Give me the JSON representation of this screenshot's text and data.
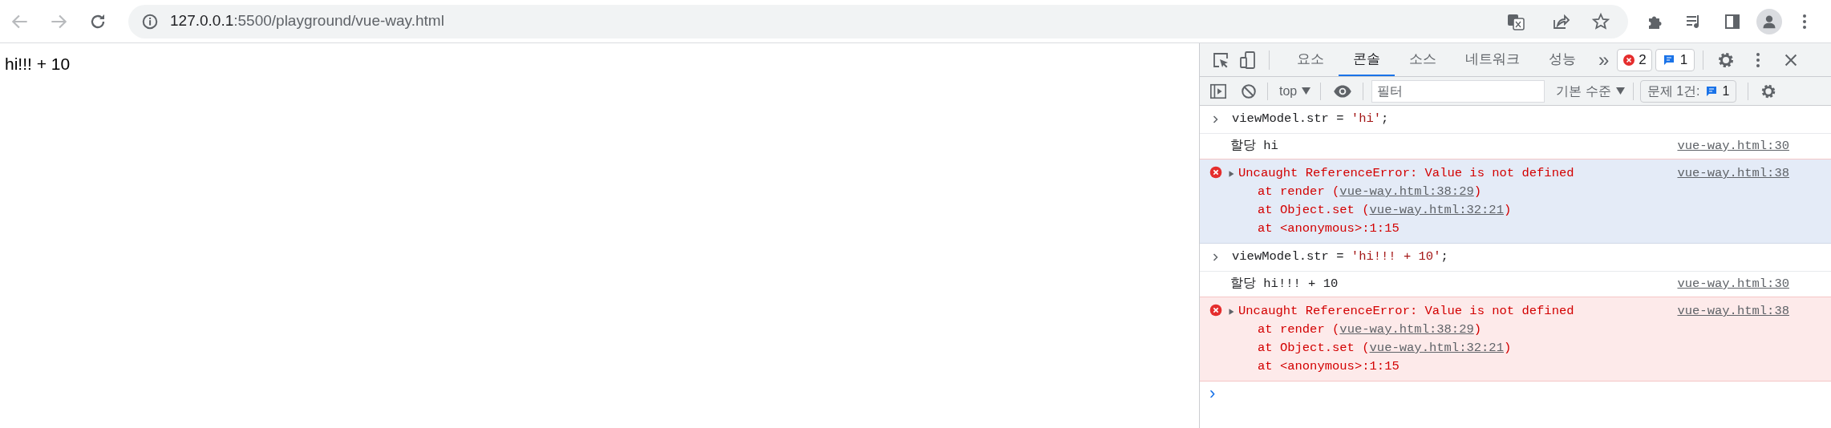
{
  "browser": {
    "back_disabled": true,
    "forward_disabled": true,
    "address": {
      "host": "127.0.0.1",
      "rest": ":5500/playground/vue-way.html"
    }
  },
  "page": {
    "text": "hi!!! + 10"
  },
  "devtools": {
    "tabs": [
      {
        "label": "요소",
        "selected": false
      },
      {
        "label": "콘솔",
        "selected": true
      },
      {
        "label": "소스",
        "selected": false
      },
      {
        "label": "네트워크",
        "selected": false
      },
      {
        "label": "성능",
        "selected": false
      }
    ],
    "more": "»",
    "error_count": "2",
    "message_count": "1",
    "context": "top",
    "filter": {
      "placeholder": "필터"
    },
    "level": "기본 수준",
    "issues_label": "문제 1건:",
    "issues_count": "1",
    "console": [
      {
        "kind": "input",
        "selected": false,
        "parts": [
          {
            "text": "viewModel.str = ",
            "string": false
          },
          {
            "text": "'hi'",
            "string": true
          },
          {
            "text": ";",
            "string": false
          }
        ]
      },
      {
        "kind": "log",
        "selected": false,
        "text": "할당 hi",
        "source": "vue-way.html:30"
      },
      {
        "kind": "error",
        "selected": true,
        "message": "Uncaught ReferenceError: Value is not defined",
        "source": "vue-way.html:38",
        "stack": [
          {
            "prefix": "at render (",
            "link": "vue-way.html:38:29",
            "suffix": ")"
          },
          {
            "prefix": "at Object.set (",
            "link": "vue-way.html:32:21",
            "suffix": ")"
          },
          {
            "prefix": "at <anonymous>:1:15"
          }
        ]
      },
      {
        "kind": "input",
        "selected": false,
        "parts": [
          {
            "text": "viewModel.str = ",
            "string": false
          },
          {
            "text": "'hi!!! + 10'",
            "string": true
          },
          {
            "text": ";",
            "string": false
          }
        ]
      },
      {
        "kind": "log",
        "selected": false,
        "text": "할당 hi!!! + 10",
        "source": "vue-way.html:30"
      },
      {
        "kind": "error",
        "selected": false,
        "message": "Uncaught ReferenceError: Value is not defined",
        "source": "vue-way.html:38",
        "stack": [
          {
            "prefix": "at render (",
            "link": "vue-way.html:38:29",
            "suffix": ")"
          },
          {
            "prefix": "at Object.set (",
            "link": "vue-way.html:32:21",
            "suffix": ")"
          },
          {
            "prefix": "at <anonymous>:1:15"
          }
        ]
      }
    ],
    "prompt": "›"
  }
}
